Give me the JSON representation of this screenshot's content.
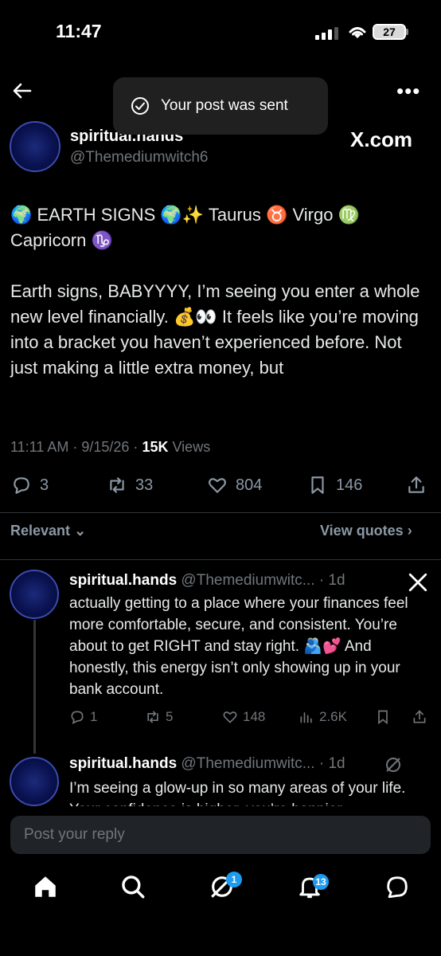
{
  "status_bar": {
    "time": "11:47",
    "battery": "27"
  },
  "toast": {
    "text": "Your post was sent"
  },
  "post": {
    "author_name": "spiritual.hands",
    "author_handle": "@Themediumwitch6",
    "source_label": "X.com",
    "line1": "🌍 EARTH SIGNS 🌍✨ Taurus ♉️ Virgo ♍️",
    "line2": "Capricorn ♑️",
    "body": "Earth signs, BABYYYY, I’m seeing you enter a whole new level financially. 💰👀 It feels like you’re moving into a bracket you haven’t experienced before. Not just making a little extra money, but",
    "time": "11:11 AM · 9/15/26 ·",
    "views_count": "15K",
    "views_label": "Views",
    "replies": "3",
    "reposts": "33",
    "likes": "804",
    "bookmarks": "146"
  },
  "sort": {
    "relevant_label": "Relevant",
    "view_quotes_label": "View quotes"
  },
  "replies": [
    {
      "name": "spiritual.hands",
      "handle_time": "@Themediumwitc... · 1d",
      "text": "actually getting to a place where your finances feel more comfortable, secure, and consistent. You’re about to get RIGHT and stay right. 🫂💕 And honestly, this energy isn’t only showing up in your bank account.",
      "replies": "1",
      "reposts": "5",
      "likes": "148",
      "views": "2.6K"
    },
    {
      "name": "spiritual.hands",
      "handle_time": "@Themediumwitc... · 1d",
      "text": "I’m seeing a glow-up in so many areas of your life. Your confidence is higher, you’re happier"
    }
  ],
  "composer": {
    "placeholder": "Post your reply"
  },
  "nav": {
    "grok_badge": "1",
    "notifications_badge": "13"
  },
  "colors": {
    "accent": "#1d9bf0",
    "background": "#000000",
    "muted": "#71767b"
  },
  "icons": [
    "back-arrow-icon",
    "more-icon",
    "check-circle-icon",
    "x-logo-icon",
    "reply-icon",
    "repost-icon",
    "like-icon",
    "bookmark-icon",
    "share-icon",
    "views-icon",
    "grok-icon",
    "home-icon",
    "search-icon",
    "grok-nav-icon",
    "bell-icon",
    "messages-icon"
  ]
}
